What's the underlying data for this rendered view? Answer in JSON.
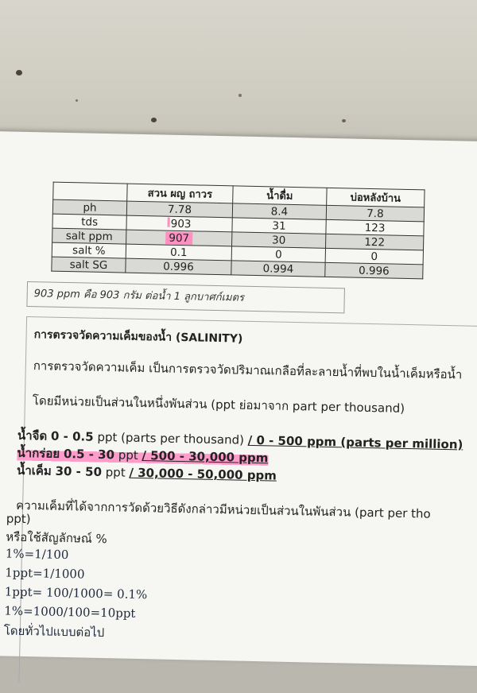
{
  "table": {
    "headers": [
      "",
      "สวน ผญ ถาวร",
      "น้ำดื่ม",
      "บ่อหลังบ้าน"
    ],
    "rows": [
      {
        "label": "ph",
        "c1": "7.78",
        "c2": "8.4",
        "c3": "7.8"
      },
      {
        "label": "tds",
        "c1": "903",
        "c2": "31",
        "c3": "123"
      },
      {
        "label": "salt ppm",
        "c1": "907",
        "c2": "30",
        "c3": "122"
      },
      {
        "label": "salt %",
        "c1": "0.1",
        "c2": "0",
        "c3": "0"
      },
      {
        "label": "salt SG",
        "c1": "0.996",
        "c2": "0.994",
        "c3": "0.996"
      }
    ]
  },
  "note": "903 ppm คือ 903 กรัม ต่อน้ำ 1 ลูกบาศก์เมตร",
  "section": {
    "heading": "การตรวจวัดความเค็มของน้ำ (SALINITY)",
    "p1": "การตรวจวัดความเค็ม เป็นการตรวจวัดปริมาณเกลือที่ละลายน้ำที่พบในน้ำเค็มหรือน้ำ",
    "p2": "โดยมีหน่วยเป็นส่วนในหนึ่งพันส่วน (ppt ย่อมาจาก part per thousand)",
    "fresh": {
      "name": "น้ำจืด",
      "range": "0 - 0.5",
      "unit": "ppt (parts per thousand)",
      "ppm": "/ 0 - 500 ppm (parts per million)"
    },
    "brackish": {
      "name": "น้ำกร่อย",
      "range": "0.5 - 30",
      "unit": "ppt",
      "ppm": "/ 500 - 30,000 ppm"
    },
    "salt": {
      "name": "น้ำเค็ม",
      "range": "30 - 50",
      "unit": "ppt",
      "ppm": "/ 30,000 - 50,000 ppm"
    },
    "p3a": "ความเค็มที่ได้จากการวัดด้วยวิธีดังกล่าวมีหน่วยเป็นส่วนในพันส่วน (part per tho",
    "p3b": "ppt)",
    "p4": "หรือใช้สัญลักษณ์ %",
    "handwritten": [
      "1%=1/100",
      "1ppt=1/1000",
      "1ppt= 100/1000= 0.1%",
      "1%=1000/100=10ppt",
      "โดยทั่วไปแบบต่อไป"
    ]
  }
}
